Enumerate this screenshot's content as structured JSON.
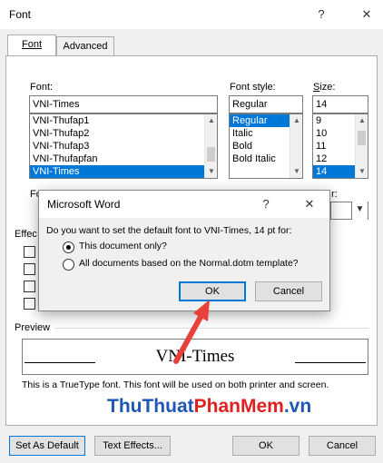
{
  "window": {
    "title": "Font",
    "help_glyph": "?",
    "close_glyph": "✕"
  },
  "tabs": [
    {
      "label": "Font"
    },
    {
      "label": "Advanced"
    }
  ],
  "font": {
    "label": "Font:",
    "value": "VNI-Times",
    "items": [
      "VNI-Thufap1",
      "VNI-Thufap2",
      "VNI-Thufap3",
      "VNI-Thufapfan",
      "VNI-Times"
    ]
  },
  "style": {
    "label": "Font style:",
    "value": "Regular",
    "items": [
      "Regular",
      "Italic",
      "Bold",
      "Bold Italic"
    ]
  },
  "size": {
    "label": "Size:",
    "value": "14",
    "items": [
      "9",
      "10",
      "11",
      "12",
      "14"
    ]
  },
  "behind_modal": {
    "font_color_label_fragment": "Fo",
    "underline_color_fragment": "r:",
    "effects_fragment": "Effec"
  },
  "modal": {
    "title": "Microsoft Word",
    "help_glyph": "?",
    "close_glyph": "✕",
    "question": "Do you want to set the default font to VNI-Times, 14 pt for:",
    "option1": "This document only?",
    "option2": "All documents based on the Normal.dotm template?",
    "ok": "OK",
    "cancel": "Cancel"
  },
  "preview": {
    "label": "Preview",
    "sample": "VNI-Times",
    "description": "This is a TrueType font. This font will be used on both printer and screen."
  },
  "watermark": {
    "part1": "ThuThuat",
    "part2": "PhanMem",
    "part3": ".vn"
  },
  "footer": {
    "set_default": "Set As Default",
    "text_effects": "Text Effects...",
    "ok": "OK",
    "cancel": "Cancel"
  },
  "colors": {
    "selection": "#0078d7",
    "arrow": "#e8413a",
    "watermark_blue": "#1f56b5",
    "watermark_red": "#e02020"
  }
}
